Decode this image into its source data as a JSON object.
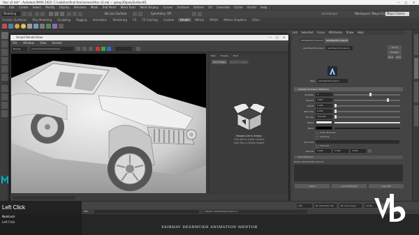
{
  "title_bar": {
    "text": "thar v2.mb* - Autodesk MAYA 2022: C:\\vaibhav\\final thar\\scenes\\thar v2.mb --- group20|polySurface61",
    "minimize": "—",
    "maximize": "□",
    "close": "✕"
  },
  "menu_bar": {
    "items": [
      "File",
      "Edit",
      "Create",
      "Select",
      "Modify",
      "Display",
      "Windows",
      "Mesh",
      "Edit Mesh",
      "Mesh Tools",
      "Mesh Display",
      "Curves",
      "Surfaces",
      "Deform",
      "UV",
      "Generate",
      "Cache",
      "Arnold",
      "Help"
    ]
  },
  "status_line": {
    "mode": "Modeling",
    "no_live_surface": "No Live Surface",
    "symmetry": "Symmetry: Off",
    "workspace": "Workspace: Maya Classic",
    "user_name": "ravinderpal",
    "workspace_field": "Maya Classic"
  },
  "shelf_tabs": [
    "Curves / Surfaces",
    "Poly Modeling",
    "Sculpting",
    "Rigging",
    "Animation",
    "Rendering",
    "FX",
    "FX Caching",
    "Custom",
    "Arnold",
    "Bifrost",
    "MASH",
    "Motion Graphics",
    "XGen"
  ],
  "active_shelf_tab_index": 9,
  "render_view": {
    "title": "Arnold RenderView",
    "menu": [
      "File",
      "Window",
      "View",
      "Render"
    ],
    "camera": "Beauty",
    "camera_dropdown": "arnold_thar:persp/Camera1",
    "panel_tabs": [
      "Main",
      "Display",
      "Bleh"
    ],
    "add_images_button": "Add Images",
    "remove_images_button": "Remove Images",
    "empty_title": "Images List is empty.",
    "empty_hint_1": "Click add to create Camera",
    "empty_hint_2": "Light Sets or Bifrost Images"
  },
  "attribute_editor": {
    "tabs": [
      "List",
      "Selected",
      "Focus",
      "Attributes",
      "Show",
      "Help"
    ],
    "node_tab_1": "aiAmbientOcclusion1",
    "node_tab_2": "aiAmbientOcclusion1",
    "node_label": "aiAmbientOcclusion:",
    "node_name": "aiAmbientOcclusion1",
    "focus_button": "Focus",
    "presets_button": "Presets",
    "show_button": "Show",
    "hide_button": "Hide",
    "type_label": "Type",
    "type_value": "aiAmbientOcclusion",
    "section_title": "Ambient Occlusion Attributes",
    "attrs": [
      {
        "label": "Samples",
        "value": "3",
        "fill": 0.55
      },
      {
        "label": "Spread",
        "value": "0.824",
        "fill": 0.82
      },
      {
        "label": "Falloff",
        "value": "0.000",
        "fill": 0.0
      },
      {
        "label": "Near Clip",
        "value": "0.000",
        "fill": 0.0
      },
      {
        "label": "Far Clip",
        "value": "100.000",
        "fill": 0.0
      }
    ],
    "white_label": "White",
    "black_label": "Black",
    "invert_normals": "Invert Normals",
    "trace_set": "Trace Set",
    "trace_set_label": "Trace Set",
    "inclusive": "Inclusive",
    "self_only": "Self Only",
    "normal_label": "Normal",
    "normal_values": [
      "0.000",
      "0.000",
      "0.000"
    ],
    "more_section": "Node Behavior",
    "notes_label": "Notes: aiAmbientOcclusion1",
    "select_button": "Select",
    "load_button": "Load Attributes",
    "copy_tab": "Copy Tab"
  },
  "timeline": {
    "start": "1",
    "end": "120",
    "range_end": "200",
    "no_character_set": "No Character Set",
    "no_anim_layer": "No Anim Layer",
    "fps": "24 fps"
  },
  "command_line": {
    "label": "MEL",
    "result": "// Result: aiAmbientOcclusion1 //"
  },
  "key_overlay": {
    "action": "Left Click",
    "key1": "NumLock",
    "key2": "Left Click"
  },
  "footer": {
    "caption": "VAIBHAV DESHMUKH ANIMATION MENTOR"
  },
  "colors": {
    "accent": "#5285a6",
    "maya_teal": "#00bcd4",
    "panel": "#444444"
  }
}
